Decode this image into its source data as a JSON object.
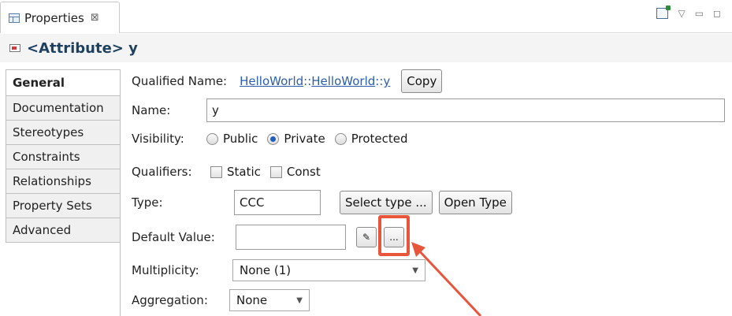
{
  "tab": {
    "label": "Properties",
    "close": "⊠"
  },
  "header": {
    "title": "<Attribute> y"
  },
  "sidebar": {
    "items": [
      {
        "label": "General"
      },
      {
        "label": "Documentation"
      },
      {
        "label": "Stereotypes"
      },
      {
        "label": "Constraints"
      },
      {
        "label": "Relationships"
      },
      {
        "label": "Property Sets"
      },
      {
        "label": "Advanced"
      }
    ],
    "active_index": 0
  },
  "form": {
    "qualified_name": {
      "label": "Qualified Name:",
      "parts": [
        "HelloWorld",
        "HelloWorld",
        "y"
      ],
      "separator": "::",
      "copy_label": "Copy"
    },
    "name": {
      "label": "Name:",
      "value": "y"
    },
    "visibility": {
      "label": "Visibility:",
      "options": [
        "Public",
        "Private",
        "Protected"
      ],
      "selected": "Private"
    },
    "qualifiers": {
      "label": "Qualifiers:",
      "options": [
        "Static",
        "Const"
      ]
    },
    "type": {
      "label": "Type:",
      "value": "CCC",
      "select_label": "Select type ...",
      "open_label": "Open Type"
    },
    "default_value": {
      "label": "Default Value:",
      "value": "",
      "browse_label": "..."
    },
    "multiplicity": {
      "label": "Multiplicity:",
      "value": "None (1)"
    },
    "aggregation": {
      "label": "Aggregation:",
      "value": "None"
    }
  },
  "colors": {
    "highlight": "#e8553b",
    "link": "#2a5db0",
    "header_title": "#1e3f5f"
  }
}
